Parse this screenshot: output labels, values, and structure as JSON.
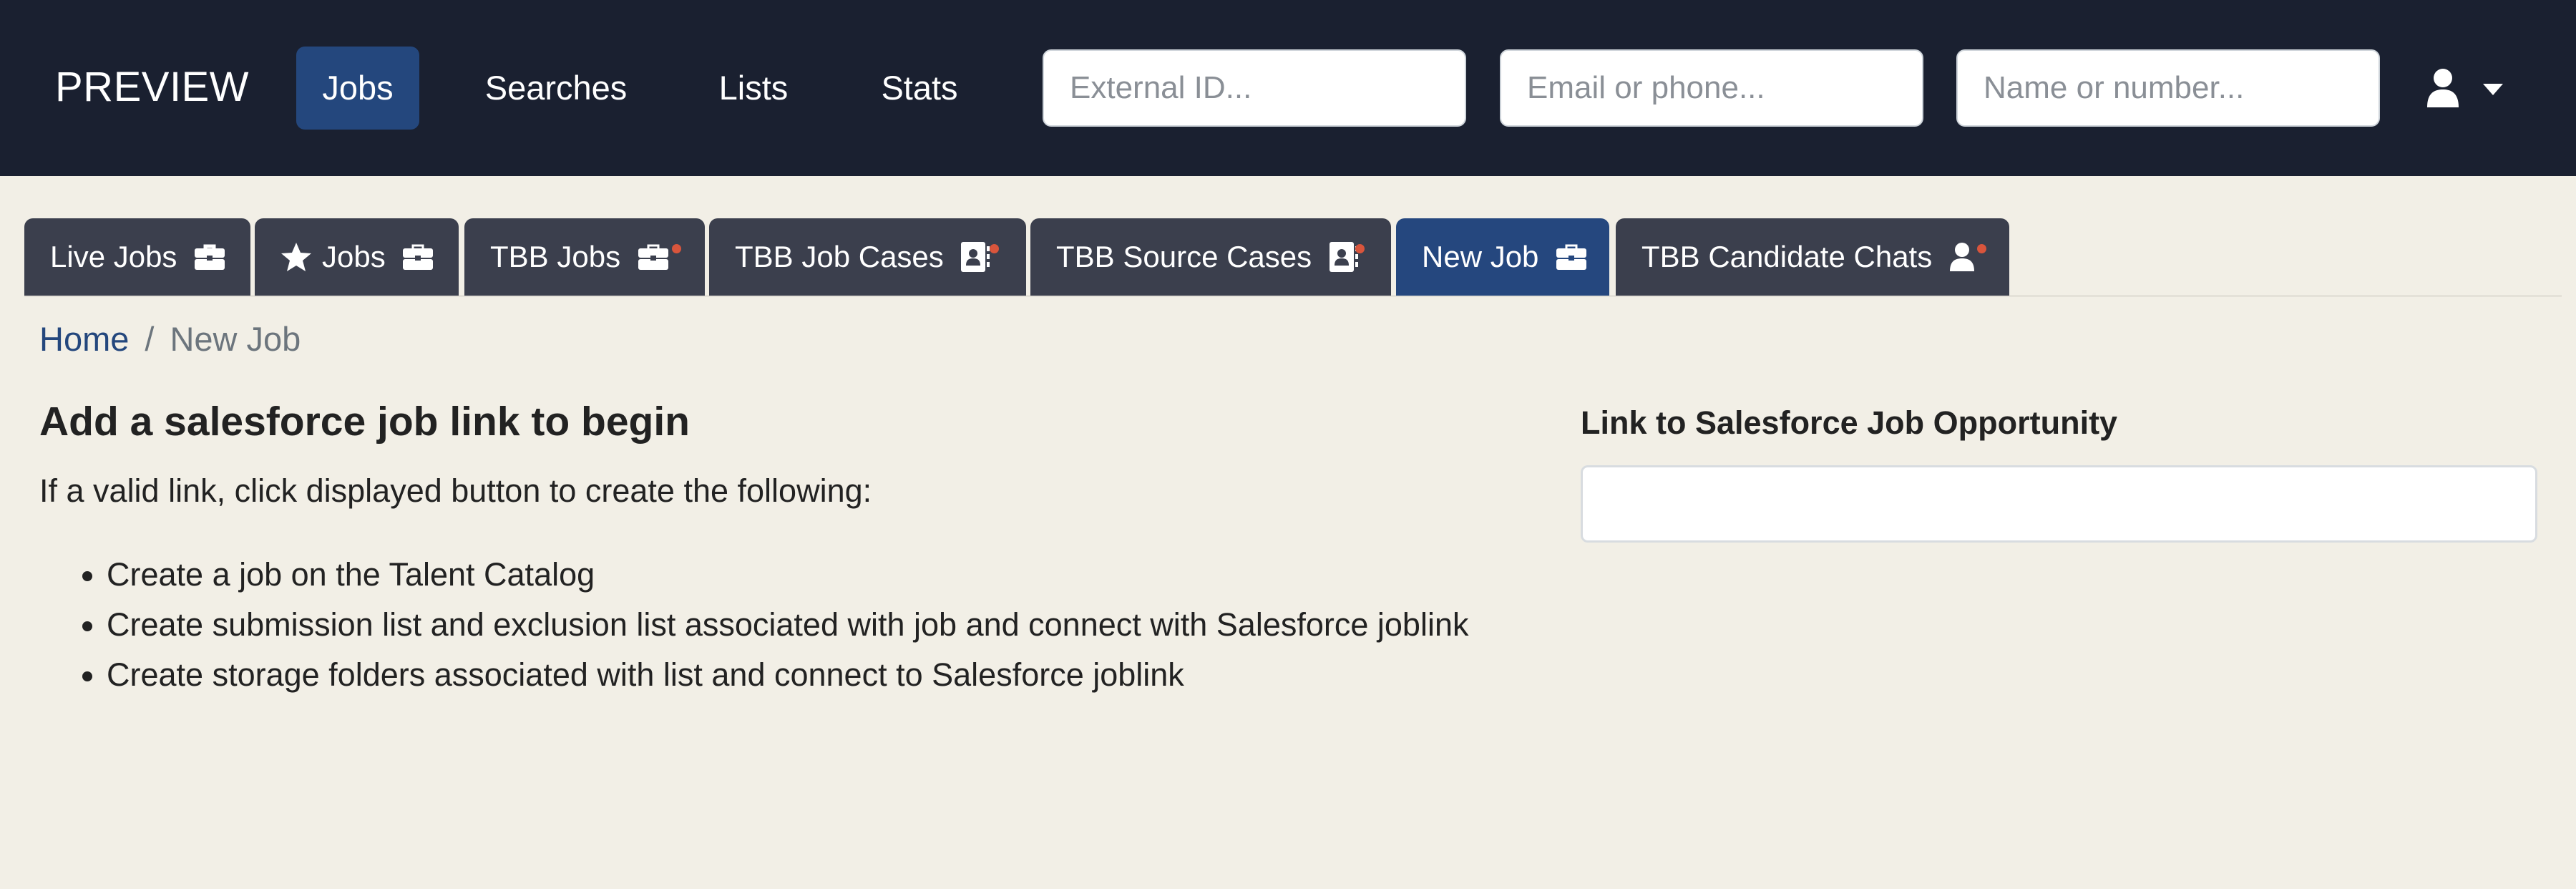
{
  "navbar": {
    "brand": "PREVIEW",
    "links": [
      {
        "label": "Jobs",
        "active": true
      },
      {
        "label": "Searches",
        "active": false
      },
      {
        "label": "Lists",
        "active": false
      },
      {
        "label": "Stats",
        "active": false
      }
    ],
    "search_inputs": [
      {
        "placeholder": "External ID...",
        "value": ""
      },
      {
        "placeholder": "Email or phone...",
        "value": ""
      },
      {
        "placeholder": "Name or number...",
        "value": ""
      }
    ],
    "user_menu_icon": "user-icon"
  },
  "tabs": [
    {
      "label": "Live Jobs",
      "icon": "briefcase-icon",
      "active": false,
      "dot": false
    },
    {
      "label": "Jobs",
      "icon": "briefcase-icon",
      "leading_icon": "star-icon",
      "active": false,
      "dot": false
    },
    {
      "label": "TBB Jobs",
      "icon": "briefcase-icon",
      "active": false,
      "dot": true
    },
    {
      "label": "TBB Job Cases",
      "icon": "contact-card-icon",
      "active": false,
      "dot": true
    },
    {
      "label": "TBB Source Cases",
      "icon": "contact-card-icon",
      "active": false,
      "dot": true
    },
    {
      "label": "New Job",
      "icon": "briefcase-icon",
      "active": true,
      "dot": false
    },
    {
      "label": "TBB Candidate Chats",
      "icon": "user-icon",
      "active": false,
      "dot": true
    }
  ],
  "breadcrumb": {
    "home": "Home",
    "separator": "/",
    "current": "New Job"
  },
  "main": {
    "heading": "Add a salesforce job link to begin",
    "lead": "If a valid link, click displayed button to create the following:",
    "steps": [
      "Create a job on the Talent Catalog",
      "Create submission list and exclusion list associated with job and connect with Salesforce joblink",
      "Create storage folders associated with list and connect to Salesforce joblink"
    ]
  },
  "form": {
    "label": "Link to Salesforce Job Opportunity",
    "value": "",
    "placeholder": ""
  },
  "colors": {
    "navbar_bg": "#1a2030",
    "accent": "#24477d",
    "tab_bg": "#3b3f4d",
    "notification_dot": "#d9553c",
    "page_bg": "#f2efe6"
  }
}
